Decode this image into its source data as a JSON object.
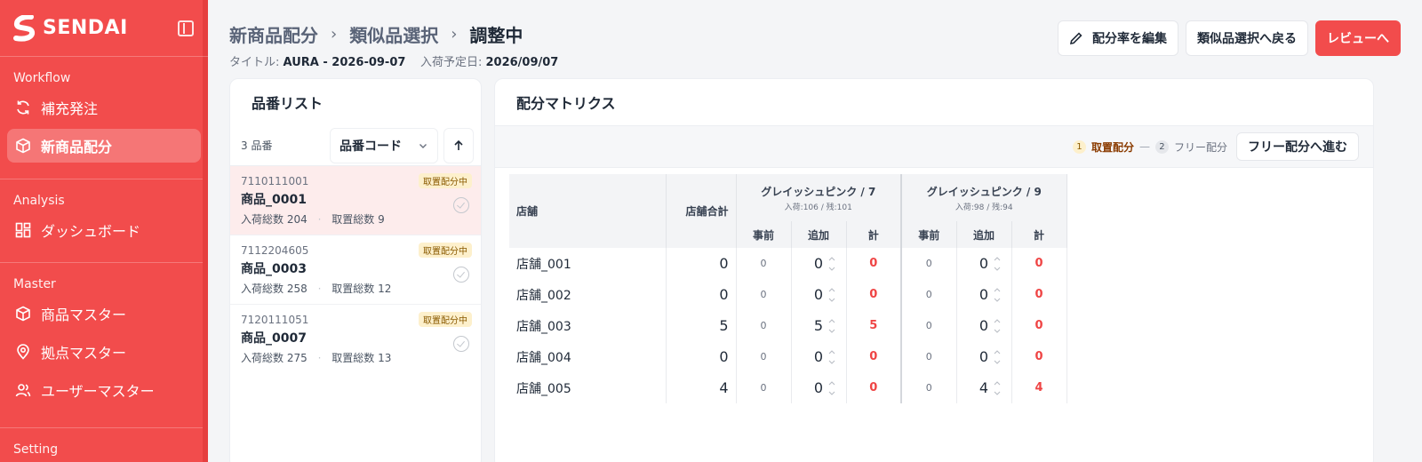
{
  "brand": {
    "name": "SENDAI"
  },
  "sidebar": {
    "sections": [
      {
        "title": "Workflow",
        "items": [
          {
            "label": "補充発注",
            "icon": "refresh-icon"
          },
          {
            "label": "新商品配分",
            "icon": "box-icon",
            "active": true
          }
        ]
      },
      {
        "title": "Analysis",
        "items": [
          {
            "label": "ダッシュボード",
            "icon": "dashboard-icon"
          }
        ]
      },
      {
        "title": "Master",
        "items": [
          {
            "label": "商品マスター",
            "icon": "box-icon"
          },
          {
            "label": "拠点マスター",
            "icon": "map-pin-icon"
          },
          {
            "label": "ユーザーマスター",
            "icon": "users-icon"
          }
        ]
      },
      {
        "title": "Setting",
        "items": []
      }
    ]
  },
  "header": {
    "breadcrumb": [
      "新商品配分",
      "類似品選択",
      "調整中"
    ],
    "title_label": "タイトル:",
    "title_value": "AURA - 2026-09-07",
    "arrival_label": "入荷予定日:",
    "arrival_value": "2026/09/07"
  },
  "actions": {
    "edit": "配分率を編集",
    "back": "類似品選択へ戻る",
    "review": "レビューへ"
  },
  "list_panel": {
    "title": "品番リスト",
    "count": "3 品番",
    "sort_label": "品番コード",
    "items": [
      {
        "code": "7110111001",
        "name": "商品_0001",
        "arrival_label": "入荷総数",
        "arrival": "204",
        "placement_label": "取置総数",
        "placement": "9",
        "badge": "取置配分中",
        "selected": true
      },
      {
        "code": "7112204605",
        "name": "商品_0003",
        "arrival_label": "入荷総数",
        "arrival": "258",
        "placement_label": "取置総数",
        "placement": "12",
        "badge": "取置配分中",
        "selected": false
      },
      {
        "code": "7120111051",
        "name": "商品_0007",
        "arrival_label": "入荷総数",
        "arrival": "275",
        "placement_label": "取置総数",
        "placement": "13",
        "badge": "取置配分中",
        "selected": false
      }
    ]
  },
  "matrix_panel": {
    "title": "配分マトリクス",
    "steps": [
      {
        "num": "1",
        "label": "取置配分"
      },
      {
        "num": "2",
        "label": "フリー配分"
      }
    ],
    "step_separator": "—",
    "next_button": "フリー配分へ進む",
    "headers": {
      "store": "店舗",
      "total": "店舗合計",
      "groups": [
        {
          "name": "グレイッシュピンク / 7",
          "sub": "入荷:106 / 残:101"
        },
        {
          "name": "グレイッシュピンク / 9",
          "sub": "入荷:98 / 残:94"
        }
      ],
      "sub": [
        "事前",
        "追加",
        "計"
      ]
    },
    "rows": [
      {
        "store": "店舗_001",
        "total": "0",
        "g": [
          {
            "pre": "0",
            "add": "0",
            "sum": "0"
          },
          {
            "pre": "0",
            "add": "0",
            "sum": "0"
          }
        ]
      },
      {
        "store": "店舗_002",
        "total": "0",
        "g": [
          {
            "pre": "0",
            "add": "0",
            "sum": "0"
          },
          {
            "pre": "0",
            "add": "0",
            "sum": "0"
          }
        ]
      },
      {
        "store": "店舗_003",
        "total": "5",
        "g": [
          {
            "pre": "0",
            "add": "5",
            "sum": "5"
          },
          {
            "pre": "0",
            "add": "0",
            "sum": "0"
          }
        ]
      },
      {
        "store": "店舗_004",
        "total": "0",
        "g": [
          {
            "pre": "0",
            "add": "0",
            "sum": "0"
          },
          {
            "pre": "0",
            "add": "0",
            "sum": "0"
          }
        ]
      },
      {
        "store": "店舗_005",
        "total": "4",
        "g": [
          {
            "pre": "0",
            "add": "0",
            "sum": "0"
          },
          {
            "pre": "0",
            "add": "4",
            "sum": "4"
          }
        ]
      }
    ]
  },
  "colors": {
    "brand": "#f24c4c",
    "badge_bg": "#fdf0cc",
    "negative": "#ef4444"
  }
}
